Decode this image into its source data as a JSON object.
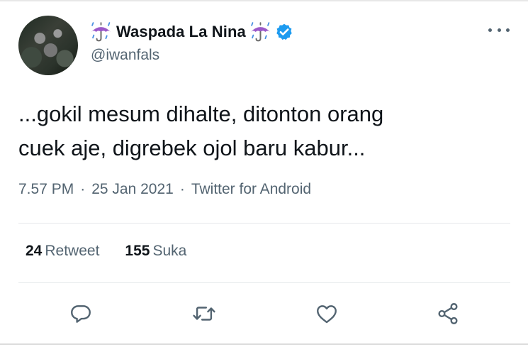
{
  "tweet": {
    "author": {
      "name": "Waspada La Nina",
      "handle": "@iwanfals",
      "verified": true,
      "emoji_icon": "umbrella-with-rain-icon"
    },
    "text_lines": [
      "...gokil mesum dihalte, ditonton orang",
      "cuek aje, digrebek ojol baru kabur..."
    ],
    "meta": {
      "time": "7.57 PM",
      "separator": "·",
      "date": "25 Jan 2021",
      "source": "Twitter for Android"
    },
    "stats": {
      "retweets_count": "24",
      "retweets_label": "Retweet",
      "likes_count": "155",
      "likes_label": "Suka"
    },
    "actions": [
      "reply-icon",
      "retweet-icon",
      "like-icon",
      "share-icon"
    ]
  },
  "colors": {
    "text": "#0f1419",
    "secondary": "#536471",
    "verified": "#1d9bf0",
    "umbrella": "#9b59c9",
    "divider": "#e6e9eb"
  }
}
